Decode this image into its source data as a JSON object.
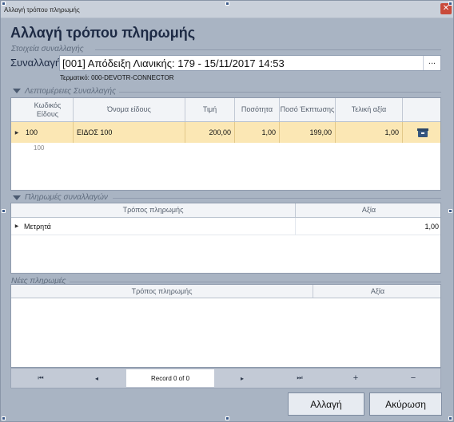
{
  "window": {
    "title": "Αλλαγή τρόπου πληρωμής",
    "close_glyph": "✕"
  },
  "heading": "Αλλαγή τρόπου πληρωμής",
  "transaction_info": {
    "group_label": "Στοιχεία συναλλαγής",
    "field_label": "Συναλλαγή",
    "value": "[001] Απόδειξη Λιανικής: 179 - 15/11/2017 14:53",
    "ellipsis": "...",
    "terminal": "Τερματικό: 000-DEVOTR-CONNECTOR"
  },
  "details": {
    "group_label": "Λεπτομέρειες Συναλλαγής",
    "columns": [
      "Κωδικός Είδους",
      "Όνομα είδους",
      "Τιμή",
      "Ποσότητα",
      "Ποσό Έκπτωσης",
      "Τελική αξία"
    ],
    "rows": [
      {
        "code": "100",
        "name": "ΕΙΔΟΣ 100",
        "price": "200,00",
        "quantity": "1,00",
        "discount": "199,00",
        "final": "1,00",
        "icon": "box-icon"
      }
    ],
    "sub_row": "100"
  },
  "payments": {
    "group_label": "Πληρωμές συναλλαγών",
    "columns": [
      "Τρόπος πληρωμής",
      "Αξία"
    ],
    "rows": [
      {
        "method": "Μετρητά",
        "value": "1,00"
      }
    ]
  },
  "new_payments": {
    "group_label": "Νέες πληρωμές",
    "columns": [
      "Τρόπος πληρωμής",
      "Αξία"
    ],
    "rows": []
  },
  "navigator": {
    "first": "⏮",
    "prev": "◂",
    "record": "Record 0 of 0",
    "next": "▸",
    "last": "⏭",
    "add": "+",
    "remove": "−"
  },
  "buttons": {
    "change": "Αλλαγή",
    "cancel": "Ακύρωση"
  },
  "colors": {
    "selected_row": "#fbe7b4",
    "window_bg": "#a9b4c3",
    "header_text": "#1d2a44"
  }
}
